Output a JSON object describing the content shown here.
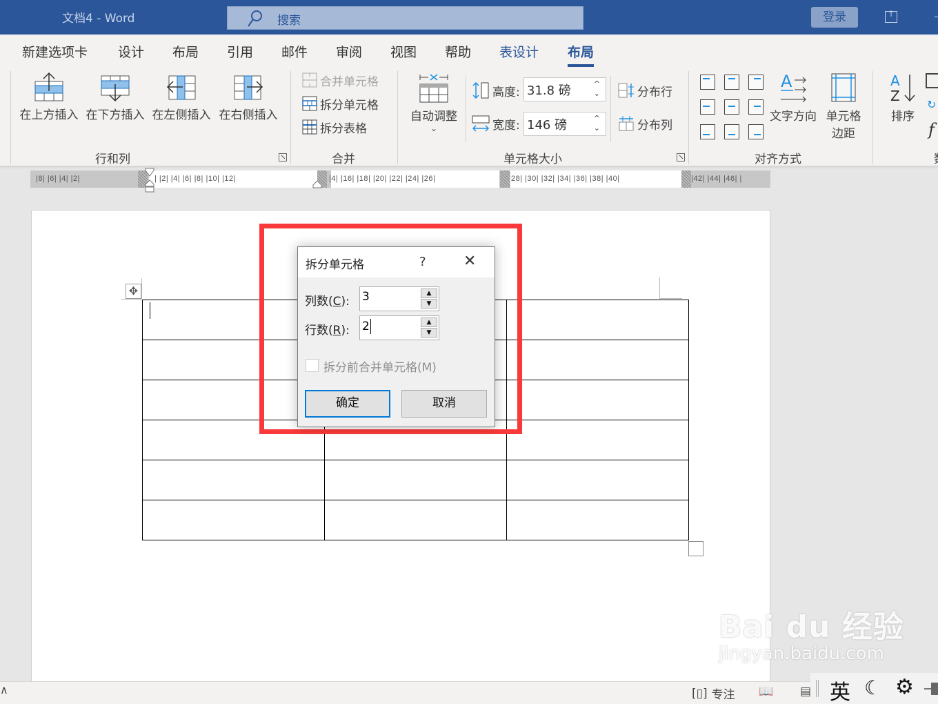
{
  "titlebar": {
    "doc_title": "文档4  -  Word",
    "search_placeholder": "搜索",
    "login_label": "登录"
  },
  "tabs": [
    {
      "label": "新建选项卡"
    },
    {
      "label": "设计"
    },
    {
      "label": "布局"
    },
    {
      "label": "引用"
    },
    {
      "label": "邮件"
    },
    {
      "label": "审阅"
    },
    {
      "label": "视图"
    },
    {
      "label": "帮助"
    },
    {
      "label": "表设计",
      "contextual": true
    },
    {
      "label": "布局",
      "active": true,
      "contextual": true
    }
  ],
  "ribbon": {
    "rows_cols": {
      "group_label": "行和列",
      "insert_above": "在上方插入",
      "insert_below": "在下方插入",
      "insert_left": "在左侧插入",
      "insert_right": "在右侧插入"
    },
    "merge": {
      "group_label": "合并",
      "merge_cells": "合并单元格",
      "split_cells": "拆分单元格",
      "split_table": "拆分表格"
    },
    "cell_size": {
      "group_label": "单元格大小",
      "autofit": "自动调整",
      "height_label": "高度:",
      "height_value": "31.8 磅",
      "width_label": "宽度:",
      "width_value": "146 磅",
      "distribute_rows": "分布行",
      "distribute_cols": "分布列"
    },
    "alignment": {
      "group_label": "对齐方式",
      "text_direction": "文字方向",
      "cell_margins_line1": "单元格",
      "cell_margins_line2": "边距"
    },
    "data": {
      "sort": "排序",
      "group_label_partial": "数"
    }
  },
  "ruler": {
    "left_ticks": "|8|   |6|   |4|   |2|",
    "ticks_a": "|   |2|   |4|   |6|   |8|   |10|  |12|",
    "ticks_b": "|4|   |16|  |18|  |20|  |22|  |24|  |26|",
    "ticks_c": "28|   |30|  |32|  |34|  |36|  |38|  |40|",
    "right_ticks": "|42|  |44|  |46|   |"
  },
  "table": {
    "rows": 6,
    "cols": 3
  },
  "dialog": {
    "title": "拆分单元格",
    "help": "?",
    "close": "✕",
    "cols_label_pre": "列数(",
    "cols_label_key": "C",
    "cols_label_post": "):",
    "cols_value": "3",
    "rows_label_pre": "行数(",
    "rows_label_key": "R",
    "rows_label_post": "):",
    "rows_value": "2",
    "merge_before_split_label": "拆分前合并单元格(M)",
    "merge_before_split_checked": false,
    "ok_label": "确定",
    "cancel_label": "取消"
  },
  "statusbar": {
    "focus_label": "专注"
  },
  "taskbar": {
    "ime_label": "英"
  },
  "watermark": {
    "main": "Bai du 经验",
    "sub": "jingyan.baidu.com"
  },
  "colors": {
    "brand": "#2b579a",
    "highlight": "#fa3a3a",
    "dialog_default_border": "#0078d7"
  }
}
